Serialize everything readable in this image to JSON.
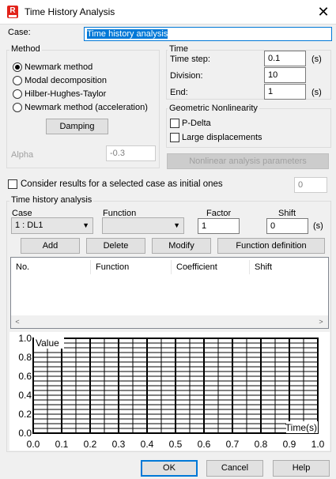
{
  "window": {
    "title": "Time History Analysis",
    "icon_letter": "R"
  },
  "case": {
    "label": "Case:",
    "value": "Time history analysis"
  },
  "method": {
    "title": "Method",
    "options": [
      "Newmark method",
      "Modal decomposition",
      "Hilber-Hughes-Taylor",
      "Newmark method (acceleration)"
    ],
    "selected": 0,
    "damping_label": "Damping",
    "alpha_label": "Alpha",
    "alpha_value": "-0.3"
  },
  "time": {
    "title": "Time",
    "step_label": "Time step:",
    "step_value": "0.1",
    "step_unit": "(s)",
    "division_label": "Division:",
    "division_value": "10",
    "end_label": "End:",
    "end_value": "1",
    "end_unit": "(s)"
  },
  "geom": {
    "title": "Geometric Nonlinearity",
    "pdelta": "P-Delta",
    "large": "Large displacements",
    "nonlinear_btn": "Nonlinear analysis parameters"
  },
  "consider": {
    "label": "Consider results for a selected case as initial ones",
    "value": "0"
  },
  "tha": {
    "title": "Time history analysis",
    "case_label": "Case",
    "case_value": "1 : DL1",
    "function_label": "Function",
    "function_value": "",
    "factor_label": "Factor",
    "factor_value": "1",
    "shift_label": "Shift",
    "shift_value": "0",
    "shift_unit": "(s)",
    "add": "Add",
    "delete": "Delete",
    "modify": "Modify",
    "function_definition": "Function definition",
    "columns": [
      "No.",
      "Function",
      "Coefficient",
      "Shift"
    ]
  },
  "plot": {
    "ylabel": "Value",
    "xlabel": "Time(s)",
    "yticks": [
      "1.0",
      "0.8",
      "0.6",
      "0.4",
      "0.2",
      "0.0"
    ],
    "xticks": [
      "0.0",
      "0.1",
      "0.2",
      "0.3",
      "0.4",
      "0.5",
      "0.6",
      "0.7",
      "0.8",
      "0.9",
      "1.0"
    ]
  },
  "footer": {
    "ok": "OK",
    "cancel": "Cancel",
    "help": "Help"
  }
}
